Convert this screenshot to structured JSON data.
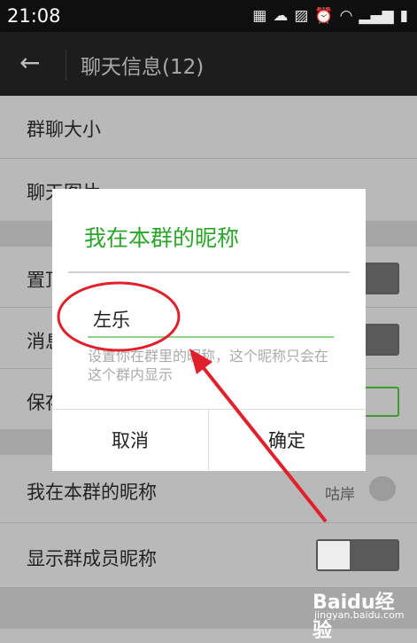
{
  "status_bar": {
    "time": "21:08",
    "icons": [
      "grid-icon",
      "cloud-icon",
      "image-icon",
      "alarm-icon",
      "wifi-icon",
      "signal-icon",
      "battery-icon"
    ]
  },
  "title_bar": {
    "title": "聊天信息(12)"
  },
  "list": {
    "group_size": "群聊大小",
    "chat_images": "聊天图片",
    "pin": "置顶",
    "mute": "消息",
    "save": "保存",
    "my_nickname": "我在本群的昵称",
    "my_nickname_value": "咕岸",
    "show_nicknames": "显示群成员昵称"
  },
  "dialog": {
    "title": "我在本群的昵称",
    "input_value": "左乐",
    "hint": "设置你在群里的昵称，这个昵称只会在这个群内显示",
    "cancel": "取消",
    "confirm": "确定"
  },
  "watermark": {
    "brand": "Baidu经验",
    "url": "jingyan.baidu.com"
  },
  "colors": {
    "accent": "#2aa52a",
    "annotation": "#e0202a"
  }
}
